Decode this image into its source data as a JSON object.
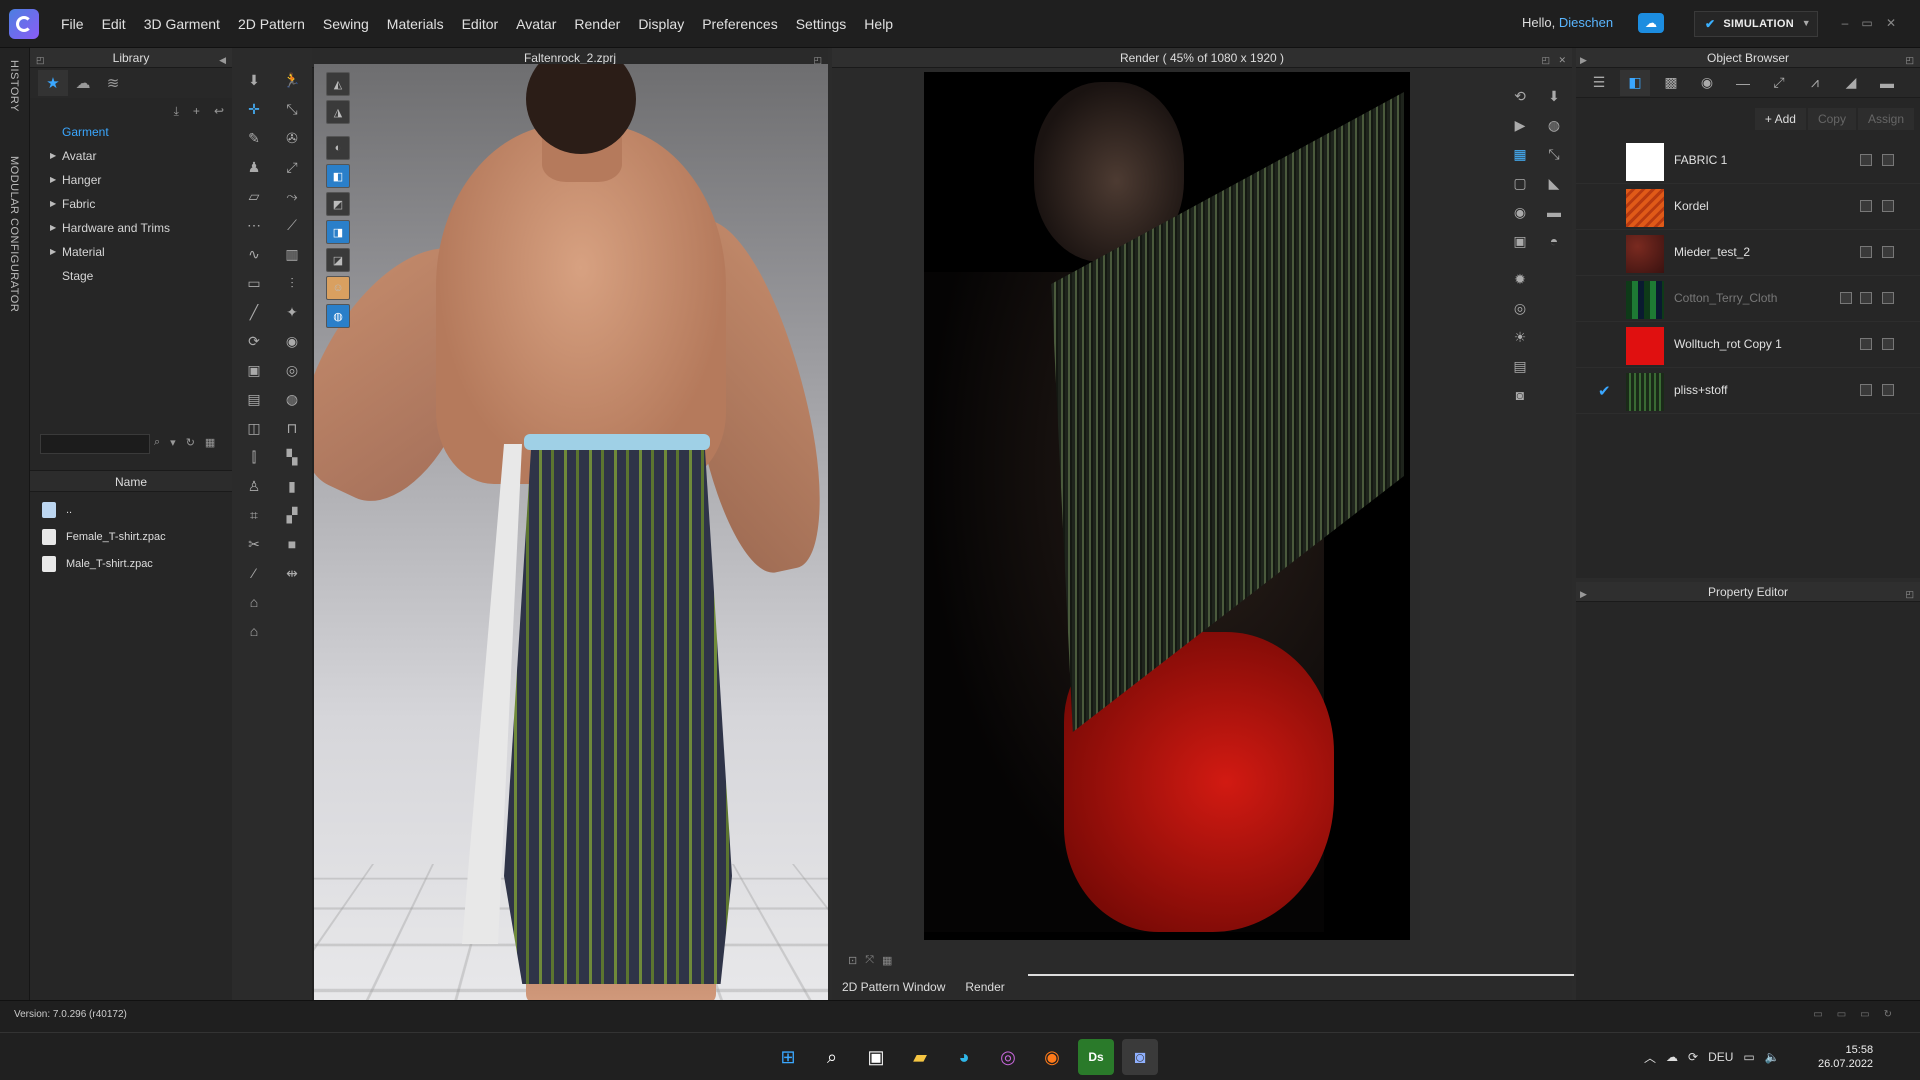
{
  "menubar": {
    "items": [
      "File",
      "Edit",
      "3D Garment",
      "2D Pattern",
      "Sewing",
      "Materials",
      "Editor",
      "Avatar",
      "Render",
      "Display",
      "Preferences",
      "Settings",
      "Help"
    ],
    "greeting": "Hello,",
    "username": "Dieschen",
    "mode_label": "SIMULATION",
    "window_controls": [
      "–",
      "▭",
      "✕"
    ]
  },
  "side_tabs": [
    "HISTORY",
    "MODULAR CONFIGURATOR"
  ],
  "library": {
    "title": "Library",
    "tree": [
      {
        "label": "Garment",
        "selected": true,
        "expandable": false
      },
      {
        "label": "Avatar",
        "expandable": true
      },
      {
        "label": "Hanger",
        "expandable": true
      },
      {
        "label": "Fabric",
        "expandable": true
      },
      {
        "label": "Hardware and Trims",
        "expandable": true
      },
      {
        "label": "Material",
        "expandable": true
      },
      {
        "label": "Stage",
        "expandable": false
      }
    ],
    "search_placeholder": "",
    "column_name": "Name",
    "files": [
      {
        "name": "..",
        "type": "folder"
      },
      {
        "name": "Female_T-shirt.zpac",
        "type": "file"
      },
      {
        "name": "Male_T-shirt.zpac",
        "type": "file"
      }
    ]
  },
  "viewport3d": {
    "title": "Faltenrock_2.zprj"
  },
  "render": {
    "title": "Render ( 45% of 1080 x 1920 )"
  },
  "bottom_tabs": [
    "2D Pattern Window",
    "Render"
  ],
  "object_browser": {
    "title": "Object Browser",
    "actions": {
      "add": "+ Add",
      "copy": "Copy",
      "assign": "Assign"
    },
    "fabrics": [
      {
        "name": "FABRIC 1",
        "swatch": "#ffffff",
        "checked": false,
        "dim": false
      },
      {
        "name": "Kordel",
        "swatch": "#d9501c",
        "checked": false,
        "dim": false
      },
      {
        "name": "Mieder_test_2",
        "swatch": "#5a1e18",
        "checked": false,
        "dim": false
      },
      {
        "name": "Cotton_Terry_Cloth",
        "swatch": "#1a5c2a",
        "checked": false,
        "dim": true
      },
      {
        "name": "Wolltuch_rot Copy 1",
        "swatch": "#e01010",
        "checked": false,
        "dim": false
      },
      {
        "name": "pliss+stoff",
        "swatch": "#2d5a2a",
        "checked": true,
        "dim": false
      }
    ]
  },
  "property_editor": {
    "title": "Property Editor"
  },
  "status": {
    "version": "Version: 7.0.296 (r40172)"
  },
  "taskbar": {
    "language": "DEU",
    "time": "15:58",
    "date": "26.07.2022"
  },
  "colors": {
    "accent": "#3aa7ff",
    "bg": "#262626"
  }
}
